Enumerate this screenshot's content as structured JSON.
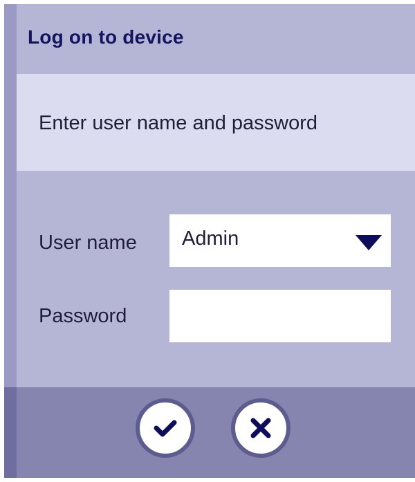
{
  "dialog": {
    "title": "Log on to device",
    "message": "Enter user name and password",
    "colors": {
      "title_bar": "#b5b5d6",
      "message_area": "#dcdcf1",
      "button_bar": "#8585b0",
      "title_text": "#141461",
      "arrow": "#0d0d5c"
    }
  },
  "form": {
    "user_label": "User name",
    "user_value": "Admin",
    "password_label": "Password",
    "password_value": ""
  },
  "buttons": {
    "ok_icon": "checkmark-icon",
    "cancel_icon": "close-icon"
  }
}
